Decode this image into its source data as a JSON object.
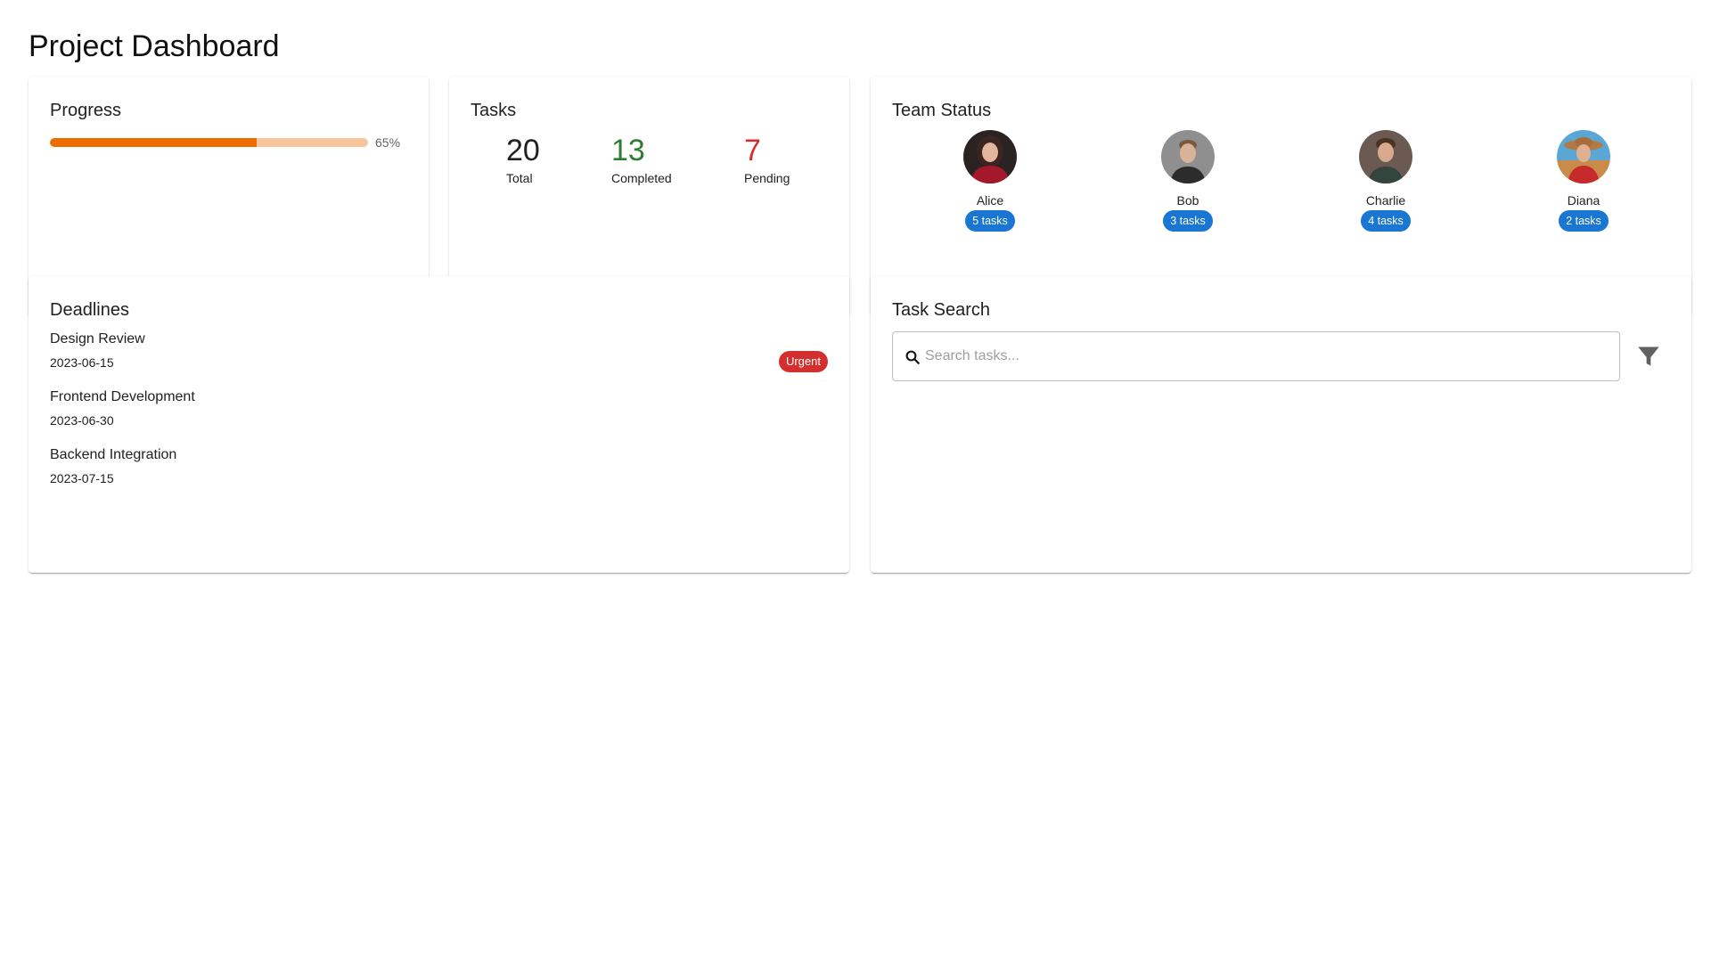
{
  "page": {
    "title": "Project Dashboard"
  },
  "progress": {
    "title": "Progress",
    "percent": 65,
    "label": "65%",
    "fill_color": "#ef6c00",
    "track_color": "#f8c49a"
  },
  "tasks": {
    "title": "Tasks",
    "stats": [
      {
        "value": "20",
        "label": "Total"
      },
      {
        "value": "13",
        "label": "Completed",
        "color": "#2e7d32"
      },
      {
        "value": "7",
        "label": "Pending",
        "color": "#d32f2f"
      }
    ]
  },
  "team": {
    "title": "Team Status",
    "badge_color": "#1976d2",
    "members": [
      {
        "name": "Alice",
        "badge": "5 tasks",
        "avatar": "photo-avatar"
      },
      {
        "name": "Bob",
        "badge": "3 tasks",
        "avatar": "photo-avatar"
      },
      {
        "name": "Charlie",
        "badge": "4 tasks",
        "avatar": "photo-avatar"
      },
      {
        "name": "Diana",
        "badge": "2 tasks",
        "avatar": "photo-avatar"
      }
    ]
  },
  "deadlines": {
    "title": "Deadlines",
    "items": [
      {
        "name": "Design Review",
        "date": "2023-06-15",
        "tag": "Urgent"
      },
      {
        "name": "Frontend Development",
        "date": "2023-06-30"
      },
      {
        "name": "Backend Integration",
        "date": "2023-07-15"
      }
    ],
    "urgent_color": "#d32f2f"
  },
  "search": {
    "title": "Task Search",
    "placeholder": "Search tasks...",
    "value": "",
    "search_icon": "search-icon",
    "filter_icon": "filter-icon"
  }
}
